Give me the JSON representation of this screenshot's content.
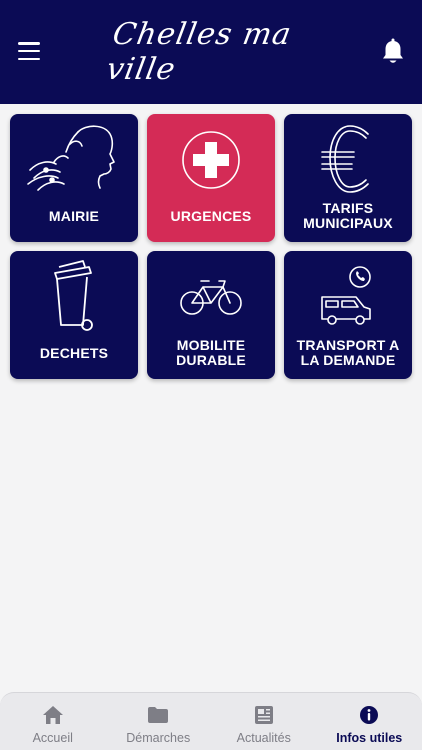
{
  "header": {
    "logo_text": "Chelles ma ville",
    "menu_icon": "hamburger-icon",
    "notif_icon": "bell-icon",
    "background_color": "#0b0b55"
  },
  "tiles": [
    {
      "label": "MAIRIE",
      "icon": "marianne-icon",
      "color": "#0b0b55"
    },
    {
      "label": "URGENCES",
      "icon": "medical-cross-icon",
      "color": "#d42b56"
    },
    {
      "label": "TARIFS\nMUNICIPAUX",
      "icon": "euro-icon",
      "color": "#0b0b55"
    },
    {
      "label": "DECHETS",
      "icon": "trash-bin-icon",
      "color": "#0b0b55"
    },
    {
      "label": "MOBILITE\nDURABLE",
      "icon": "bicycle-icon",
      "color": "#0b0b55"
    },
    {
      "label": "TRANSPORT A\nLA DEMANDE",
      "icon": "van-phone-icon",
      "color": "#0b0b55"
    }
  ],
  "tabbar": {
    "tabs": [
      {
        "label": "Accueil",
        "icon": "home-icon",
        "active": false
      },
      {
        "label": "Démarches",
        "icon": "folder-icon",
        "active": false
      },
      {
        "label": "Actualités",
        "icon": "newspaper-icon",
        "active": false
      },
      {
        "label": "Infos utiles",
        "icon": "info-icon",
        "active": true
      }
    ],
    "active_color": "#0b0b55",
    "inactive_color": "#7e7e86"
  }
}
